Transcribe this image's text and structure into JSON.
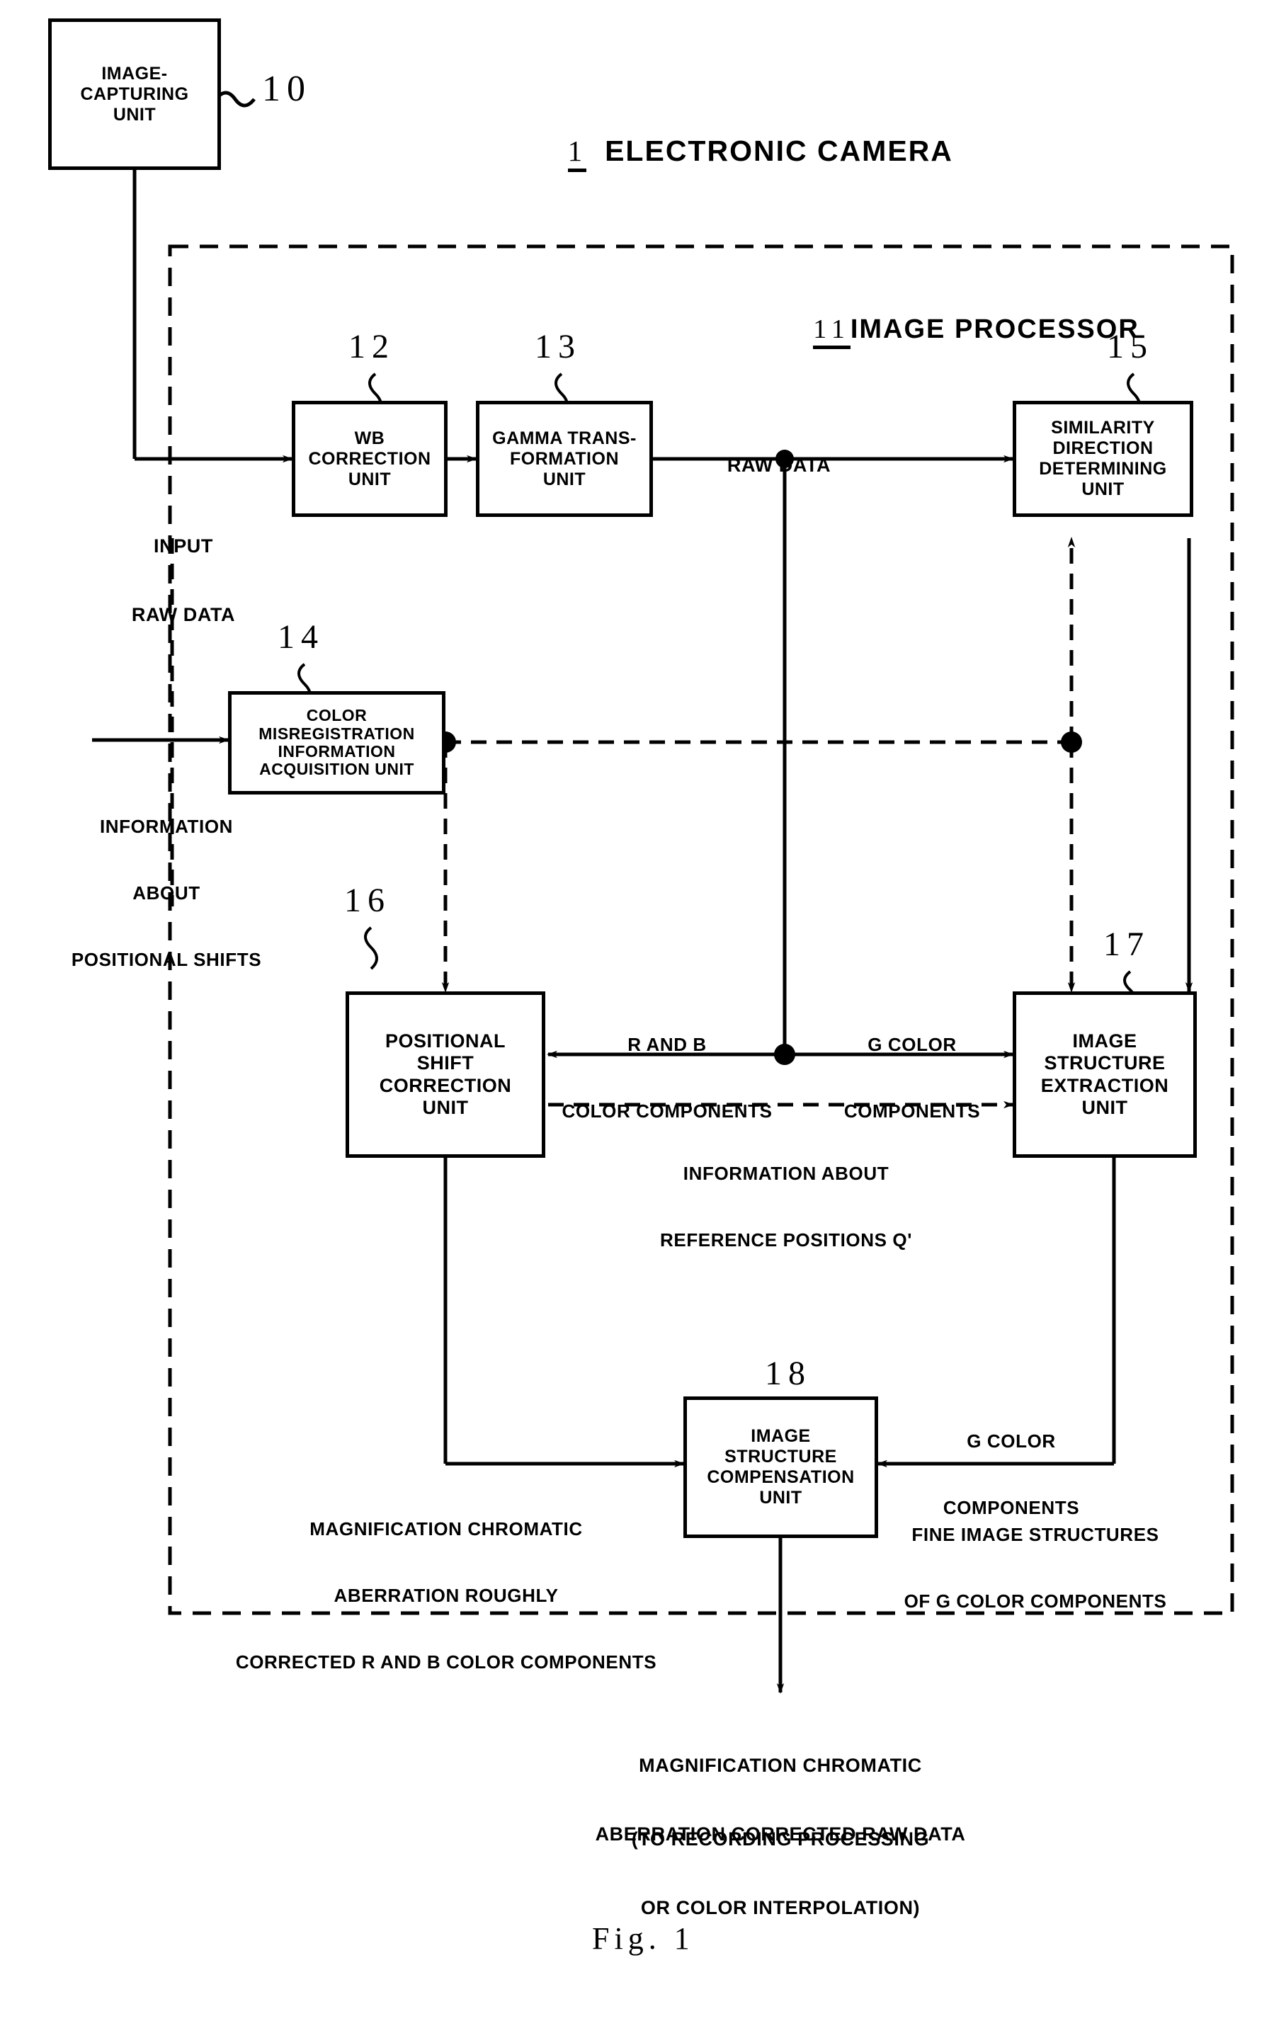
{
  "figure": {
    "caption": "Fig. 1",
    "title_ref": "1",
    "title_text": "ELECTRONIC CAMERA",
    "processor_ref": "11",
    "processor_text": "IMAGE PROCESSOR"
  },
  "blocks": [
    {
      "id": "image-capturing-unit",
      "ref": "10",
      "lines": [
        "IMAGE-",
        "CAPTURING",
        "UNIT"
      ]
    },
    {
      "id": "wb-correction-unit",
      "ref": "12",
      "lines": [
        "WB",
        "CORRECTION",
        "UNIT"
      ]
    },
    {
      "id": "gamma-transformation-unit",
      "ref": "13",
      "lines": [
        "GAMMA TRANS-",
        "FORMATION",
        "UNIT"
      ]
    },
    {
      "id": "color-misregistration-information-acquisition-unit",
      "ref": "14",
      "lines": [
        "COLOR",
        "MISREGISTRATION",
        "INFORMATION",
        "ACQUISITION UNIT"
      ]
    },
    {
      "id": "similarity-direction-determining-unit",
      "ref": "15",
      "lines": [
        "SIMILARITY",
        "DIRECTION",
        "DETERMINING",
        "UNIT"
      ]
    },
    {
      "id": "positional-shift-correction-unit",
      "ref": "16",
      "lines": [
        "POSITIONAL",
        "SHIFT",
        "CORRECTION",
        "UNIT"
      ]
    },
    {
      "id": "image-structure-extraction-unit",
      "ref": "17",
      "lines": [
        "IMAGE",
        "STRUCTURE",
        "EXTRACTION",
        "UNIT"
      ]
    },
    {
      "id": "image-structure-compensation-unit",
      "ref": "18",
      "lines": [
        "IMAGE",
        "STRUCTURE",
        "COMPENSATION",
        "UNIT"
      ]
    }
  ],
  "annotations": {
    "input_raw_data": [
      "INPUT",
      "RAW DATA"
    ],
    "raw_data": [
      "RAW DATA"
    ],
    "positional_shifts": [
      "INFORMATION",
      "ABOUT",
      "POSITIONAL SHIFTS"
    ],
    "rb_color_components": [
      "R AND B",
      "COLOR COMPONENTS"
    ],
    "g_color_components_mid": [
      "G COLOR",
      "COMPONENTS"
    ],
    "reference_positions": [
      "INFORMATION ABOUT",
      "REFERENCE POSITIONS Q'"
    ],
    "g_color_components_low": [
      "G COLOR",
      "COMPONENTS"
    ],
    "roughly_corrected": [
      "MAGNIFICATION CHROMATIC",
      "ABERRATION ROUGHLY",
      "CORRECTED R AND B COLOR COMPONENTS"
    ],
    "fine_image_structures": [
      "FINE IMAGE STRUCTURES",
      "OF G COLOR COMPONENTS"
    ],
    "output_main": [
      "MAGNIFICATION CHROMATIC",
      "ABERRATION CORRECTED RAW DATA"
    ],
    "output_sub": [
      "(TO RECORDING PROCESSING",
      "OR COLOR INTERPOLATION)"
    ]
  },
  "colors": {
    "ink": "#000000",
    "paper": "#ffffff"
  }
}
